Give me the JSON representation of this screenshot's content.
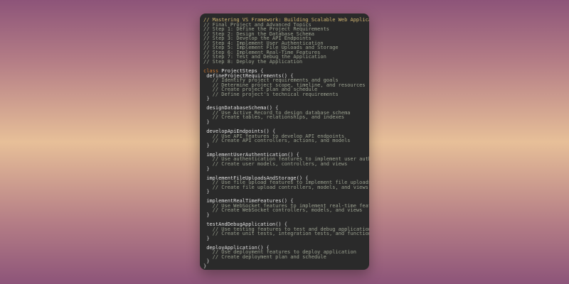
{
  "editor": {
    "header_comments": [
      "// Mastering VS Framework: Building Scalable Web Applications",
      "// Final Project and Advanced Topics",
      "// Step 1: Define the Project Requirements",
      "// Step 2: Design the Database Schema",
      "// Step 3: Develop the API Endpoints",
      "// Step 4: Implement User Authentication",
      "// Step 5: Implement File Uploads and Storage",
      "// Step 6: Implement Real-Time Features",
      "// Step 7: Test and Debug the Application",
      "// Step 8: Deploy the Application"
    ],
    "class_keyword": "class",
    "class_name": "ProjectSteps",
    "methods": [
      {
        "name": "defineProjectRequirements()",
        "comments": [
          "// Identify project requirements and goals",
          "// Determine project scope, timeline, and resources",
          "// Create project plan and schedule",
          "// Define project's technical requirements"
        ]
      },
      {
        "name": "designDatabaseSchema()",
        "comments": [
          "// Use Active Record to design database schema",
          "// Create tables, relationships, and indexes"
        ]
      },
      {
        "name": "developApiEndpoints()",
        "comments": [
          "// Use API features to develop API endpoints",
          "// Create API controllers, actions, and models"
        ]
      },
      {
        "name": "implementUserAuthentication()",
        "comments": [
          "// Use authentication features to implement user authentication",
          "// Create user models, controllers, and views"
        ]
      },
      {
        "name": "implementFileUploadsAndStorage()",
        "comments": [
          "// Use file upload features to implement file uploads and storage",
          "// Create file upload controllers, models, and views"
        ]
      },
      {
        "name": "implementRealTimeFeatures()",
        "comments": [
          "// Use WebSocket features to implement real-time features",
          "// Create WebSocket controllers, models, and views"
        ]
      },
      {
        "name": "testAndDebugApplication()",
        "comments": [
          "// Use testing features to test and debug application",
          "// Create unit tests, integration tests, and functional tests"
        ]
      },
      {
        "name": "deployApplication()",
        "comments": [
          "// Use deployment features to deploy application",
          "// Create deployment plan and schedule"
        ]
      }
    ],
    "brace_open": "{",
    "brace_close": "}",
    "colors": {
      "background": "#2a2a2a",
      "comment": "#9aa08f",
      "comment_title": "#d0b470",
      "keyword": "#cc7832",
      "text": "#e6e6e6"
    }
  }
}
